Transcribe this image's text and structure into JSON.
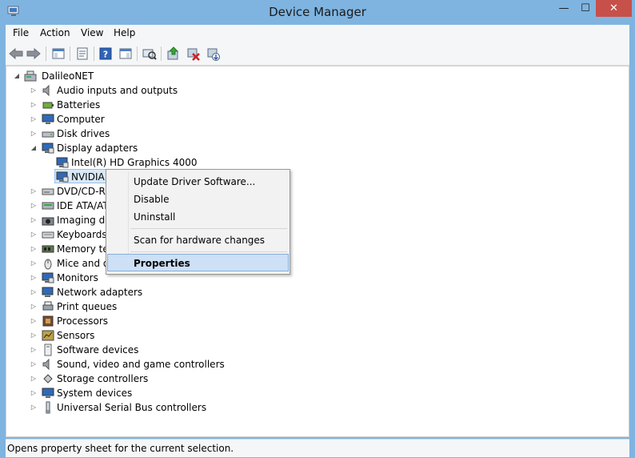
{
  "window": {
    "title": "Device Manager",
    "minimize": "—",
    "maximize": "☐",
    "close": "✕"
  },
  "menu": {
    "items": [
      "File",
      "Action",
      "View",
      "Help"
    ]
  },
  "toolbar": {
    "buttons": [
      "back-icon",
      "forward-icon",
      "show-hide-console-tree-icon",
      "properties-icon",
      "help-icon",
      "action-pane-icon",
      "scan-hardware-icon",
      "update-driver-icon",
      "uninstall-icon",
      "enable-device-icon"
    ]
  },
  "tree": {
    "root": "DalileoNET",
    "items": [
      {
        "label": "Audio inputs and outputs",
        "icon": "speaker-icon",
        "expanded": false
      },
      {
        "label": "Batteries",
        "icon": "battery-icon",
        "expanded": false
      },
      {
        "label": "Computer",
        "icon": "computer-icon",
        "expanded": false
      },
      {
        "label": "Disk drives",
        "icon": "disk-icon",
        "expanded": false
      },
      {
        "label": "Display adapters",
        "icon": "monitor-icon",
        "expanded": true
      },
      {
        "label": "Intel(R) HD Graphics 4000",
        "icon": "monitor-icon",
        "child": true
      },
      {
        "label": "NVIDIA",
        "icon": "monitor-icon",
        "child": true,
        "selected": true
      },
      {
        "label": "DVD/CD-RO",
        "icon": "dvd-icon",
        "expanded": false
      },
      {
        "label": "IDE ATA/AT",
        "icon": "ide-icon",
        "expanded": false
      },
      {
        "label": "Imaging de",
        "icon": "camera-icon",
        "expanded": false
      },
      {
        "label": "Keyboards",
        "icon": "keyboard-icon",
        "expanded": false
      },
      {
        "label": "Memory tec",
        "icon": "memory-icon",
        "expanded": false
      },
      {
        "label": "Mice and ot",
        "icon": "mouse-icon",
        "expanded": false
      },
      {
        "label": "Monitors",
        "icon": "monitor-icon",
        "expanded": false
      },
      {
        "label": "Network adapters",
        "icon": "network-icon",
        "expanded": false
      },
      {
        "label": "Print queues",
        "icon": "printer-icon",
        "expanded": false
      },
      {
        "label": "Processors",
        "icon": "cpu-icon",
        "expanded": false
      },
      {
        "label": "Sensors",
        "icon": "sensor-icon",
        "expanded": false
      },
      {
        "label": "Software devices",
        "icon": "software-icon",
        "expanded": false
      },
      {
        "label": "Sound, video and game controllers",
        "icon": "speaker-icon",
        "expanded": false
      },
      {
        "label": "Storage controllers",
        "icon": "storage-icon",
        "expanded": false
      },
      {
        "label": "System devices",
        "icon": "computer-icon",
        "expanded": false
      },
      {
        "label": "Universal Serial Bus controllers",
        "icon": "usb-icon",
        "expanded": false
      }
    ]
  },
  "context_menu": {
    "update_driver": "Update Driver Software...",
    "disable": "Disable",
    "uninstall": "Uninstall",
    "scan": "Scan for hardware changes",
    "properties": "Properties"
  },
  "status": {
    "text": "Opens property sheet for the current selection."
  },
  "colors": {
    "titlebar": "#7fb4e0",
    "close": "#c7504a",
    "selection": "#cde0f5"
  }
}
